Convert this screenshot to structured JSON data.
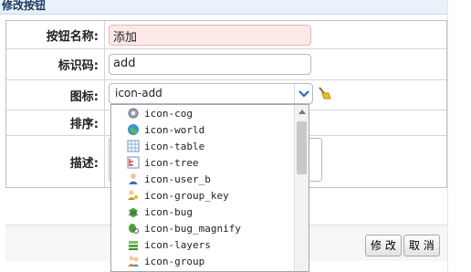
{
  "window": {
    "title": "修改按钮"
  },
  "form": {
    "name_label": "按钮名称:",
    "name_value": "添加",
    "code_label": "标识码:",
    "code_value": "add",
    "icon_label": "图标:",
    "icon_value": "icon-add",
    "order_label": "排序:",
    "desc_label": "描述:"
  },
  "buttons": {
    "modify": "修 改",
    "cancel": "取 消"
  },
  "dropdown": {
    "items": [
      {
        "label": "icon-cog",
        "icon": "cog-icon"
      },
      {
        "label": "icon-world",
        "icon": "world-icon"
      },
      {
        "label": "icon-table",
        "icon": "table-icon"
      },
      {
        "label": "icon-tree",
        "icon": "tree-icon"
      },
      {
        "label": "icon-user_b",
        "icon": "user-icon"
      },
      {
        "label": "icon-group_key",
        "icon": "group-key-icon"
      },
      {
        "label": "icon-bug",
        "icon": "bug-icon"
      },
      {
        "label": "icon-bug_magnify",
        "icon": "bug-magnify-icon"
      },
      {
        "label": "icon-layers",
        "icon": "layers-icon"
      },
      {
        "label": "icon-group",
        "icon": "group-icon"
      }
    ]
  },
  "colors": {
    "title_bar": "#e9f1fb",
    "accent": "#3e7bc4",
    "invalid_bg": "#fde8e8"
  }
}
